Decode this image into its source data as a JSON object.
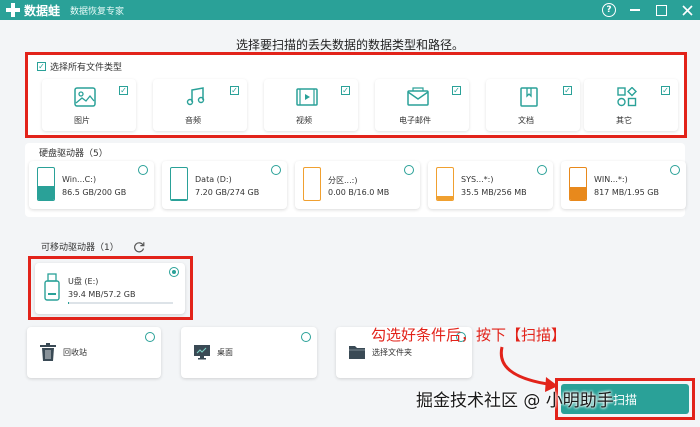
{
  "app": {
    "name": "数据蛙",
    "subtitle": "数据恢复专家",
    "help": "?"
  },
  "heading": "选择要扫描的丢失数据的数据类型和路径。",
  "file_types": {
    "select_all": "选择所有文件类型",
    "items": [
      {
        "label": "图片",
        "icon": "image-icon",
        "checked": true
      },
      {
        "label": "音频",
        "icon": "music-icon",
        "checked": true
      },
      {
        "label": "视频",
        "icon": "video-icon",
        "checked": true
      },
      {
        "label": "电子邮件",
        "icon": "email-icon",
        "checked": true
      },
      {
        "label": "文档",
        "icon": "document-icon",
        "checked": true
      },
      {
        "label": "其它",
        "icon": "other-icon",
        "checked": true
      }
    ]
  },
  "hard_drives": {
    "label": "硬盘驱动器（5）",
    "items": [
      {
        "name": "Win...C:)",
        "size": "86.5 GB/200 GB",
        "fill": 0.43,
        "color": "#2aa198"
      },
      {
        "name": "Data (D:)",
        "size": "7.20 GB/274 GB",
        "fill": 0.03,
        "color": "#2aa198"
      },
      {
        "name": "分区...:)",
        "size": "0.00  B/16.0 MB",
        "fill": 0.0,
        "color": "#f0a030"
      },
      {
        "name": "SYS...*:)",
        "size": "35.5 MB/256 MB",
        "fill": 0.14,
        "color": "#f0a030"
      },
      {
        "name": "WIN...*:)",
        "size": "817 MB/1.95 GB",
        "fill": 0.42,
        "color": "#e8891c"
      }
    ]
  },
  "removable": {
    "label": "可移动驱动器（1）",
    "drive": {
      "name": "U盘 (E:)",
      "size": "39.4 MB/57.2 GB",
      "fill": 0.01,
      "selected": true
    }
  },
  "locations": [
    {
      "label": "回收站",
      "icon": "recycle-bin-icon"
    },
    {
      "label": "桌面",
      "icon": "desktop-icon"
    },
    {
      "label": "选择文件夹",
      "icon": "folder-icon"
    }
  ],
  "annotation": "勾选好条件后，按下【扫描】",
  "scan_button": "扫描",
  "watermark": "掘金技术社区 @ 小明助手",
  "colors": {
    "accent": "#2aa198",
    "highlight": "#e2231a"
  }
}
